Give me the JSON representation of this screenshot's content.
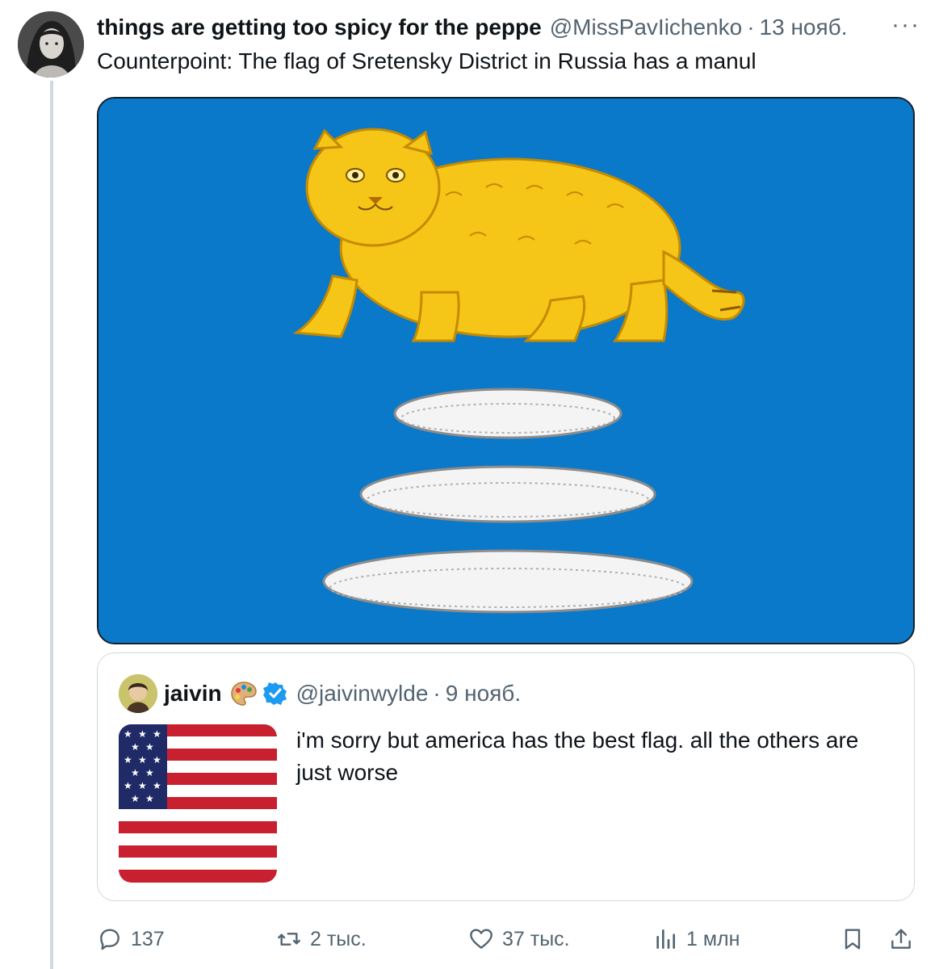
{
  "tweet": {
    "display_name": "things are getting too spicy for the peppe",
    "handle": "@MissPavIichenko",
    "separator": "·",
    "time": "13 нояб.",
    "more_label": "···",
    "text": "Counterpoint: The flag of Sretensky District in Russia has a manul",
    "avatar_icon": "user-avatar-photo",
    "media_icon": "flag-of-sretensky-district-image"
  },
  "quote": {
    "display_name": "jaivin",
    "emoji_icon": "artist-palette-icon",
    "verified_icon": "verified-badge-icon",
    "handle": "@jaivinwylde",
    "separator": "·",
    "time": "9 нояб.",
    "text": "i'm sorry but america has the best flag. all the others are just worse",
    "thumbnail_icon": "us-flag-image"
  },
  "actions": {
    "reply_count": "137",
    "retweet_count": "2 тыс.",
    "like_count": "37 тыс.",
    "views_count": "1 млн"
  },
  "colors": {
    "flag_blue": "#0a79c9",
    "manul_gold": "#f5c518",
    "secondary_text": "#536471",
    "verified_blue": "#1d9bf0"
  }
}
